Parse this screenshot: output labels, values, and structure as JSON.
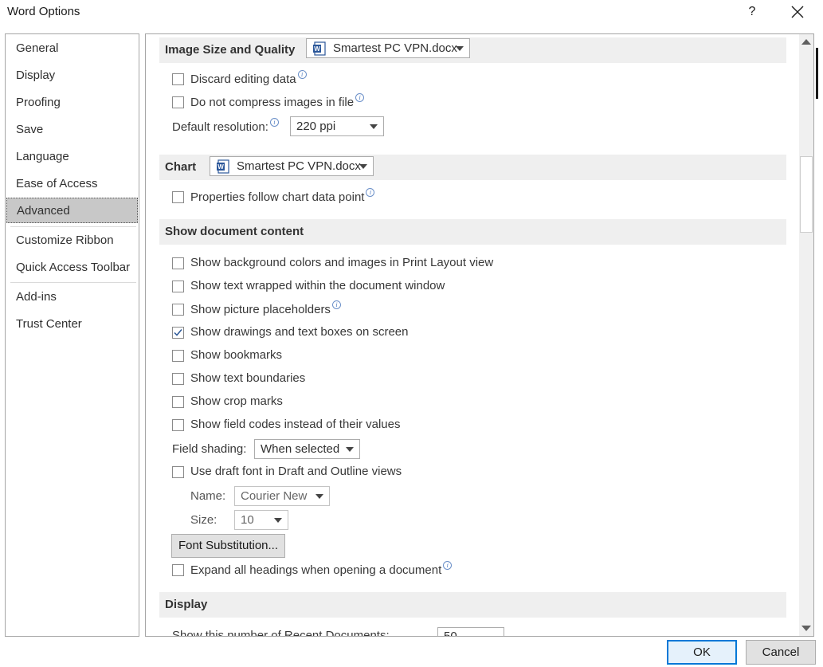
{
  "window": {
    "title": "Word Options",
    "help": "?"
  },
  "sidebar": {
    "items": [
      {
        "label": "General"
      },
      {
        "label": "Display"
      },
      {
        "label": "Proofing"
      },
      {
        "label": "Save"
      },
      {
        "label": "Language"
      },
      {
        "label": "Ease of Access"
      },
      {
        "label": "Advanced",
        "selected": true
      },
      {
        "label": "Customize Ribbon"
      },
      {
        "label": "Quick Access Toolbar"
      },
      {
        "label": "Add-ins"
      },
      {
        "label": "Trust Center"
      }
    ]
  },
  "image_section": {
    "header": "Image Size and Quality",
    "doc_select": "Smartest PC VPN.docx",
    "discard_label": "Discard editing data",
    "discard_checked": false,
    "compress_label": "Do not compress images in file",
    "compress_checked": false,
    "resolution_label": "Default resolution:",
    "resolution_value": "220 ppi"
  },
  "chart_section": {
    "header": "Chart",
    "doc_select": "Smartest PC VPN.docx",
    "properties_label": "Properties follow chart data point",
    "properties_checked": false
  },
  "show_content": {
    "header": "Show document content",
    "options": [
      {
        "label": "Show background colors and images in Print Layout view",
        "checked": false
      },
      {
        "label": "Show text wrapped within the document window",
        "checked": false
      },
      {
        "label": "Show picture placeholders",
        "checked": false
      },
      {
        "label": "Show drawings and text boxes on screen",
        "checked": true
      },
      {
        "label": "Show bookmarks",
        "checked": false
      },
      {
        "label": "Show text boundaries",
        "checked": false
      },
      {
        "label": "Show crop marks",
        "checked": false
      },
      {
        "label": "Show field codes instead of their values",
        "checked": false
      }
    ],
    "field_shading_label": "Field shading:",
    "field_shading_value": "When selected",
    "draft_font_label": "Use draft font in Draft and Outline views",
    "draft_font_checked": false,
    "name_label": "Name:",
    "name_value": "Courier New",
    "size_label": "Size:",
    "size_value": "10",
    "font_sub_button": "Font Substitution...",
    "expand_label": "Expand all headings when opening a document",
    "expand_checked": false
  },
  "display_section": {
    "header": "Display",
    "recent_docs_label": "Show this number of Recent Documents:",
    "recent_docs_value": "50"
  },
  "footer": {
    "ok": "OK",
    "cancel": "Cancel"
  },
  "colors": {
    "accent": "#0078d7",
    "selected_nav": "#c8c8c8",
    "section_header": "#efefef"
  }
}
